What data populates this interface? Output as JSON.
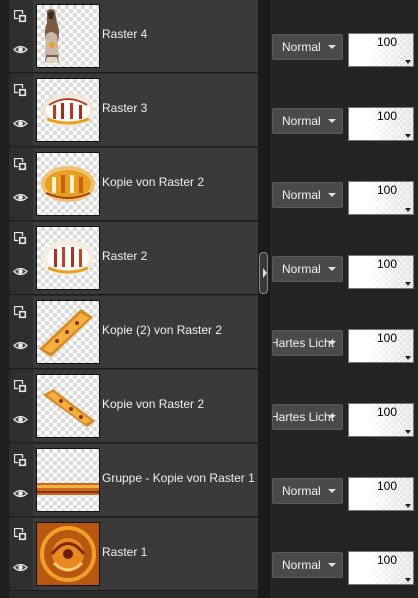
{
  "layers": [
    {
      "name": "Raster 4",
      "thumbnail": "woman-figure",
      "type_icon": "layer-type-icon",
      "visibility_icon": "eye-icon"
    },
    {
      "name": "Raster 3",
      "thumbnail": "oval-vignette",
      "type_icon": "layer-type-icon",
      "visibility_icon": "eye-icon"
    },
    {
      "name": "Kopie von Raster 2",
      "thumbnail": "gold-oval",
      "type_icon": "layer-type-icon",
      "visibility_icon": "eye-icon"
    },
    {
      "name": "Raster 2",
      "thumbnail": "oval-vignette",
      "type_icon": "layer-type-icon",
      "visibility_icon": "eye-icon"
    },
    {
      "name": "Kopie (2) von Raster 2",
      "thumbnail": "diagonal-strip",
      "type_icon": "layer-type-icon",
      "visibility_icon": "eye-icon"
    },
    {
      "name": "Kopie von Raster 2",
      "thumbnail": "diagonal-strip-thin",
      "type_icon": "layer-type-icon",
      "visibility_icon": "eye-icon"
    },
    {
      "name": "Gruppe - Kopie von Raster 1",
      "thumbnail": "bottom-border",
      "type_icon": "layer-type-icon",
      "visibility_icon": "eye-icon"
    },
    {
      "name": "Raster 1",
      "thumbnail": "orange-fractal",
      "type_icon": "layer-type-icon",
      "visibility_icon": "eye-icon"
    }
  ],
  "properties": [
    {
      "blend_mode": "Normal",
      "opacity": "100"
    },
    {
      "blend_mode": "Normal",
      "opacity": "100"
    },
    {
      "blend_mode": "Normal",
      "opacity": "100"
    },
    {
      "blend_mode": "Normal",
      "opacity": "100"
    },
    {
      "blend_mode": "Hartes Licht",
      "opacity": "100"
    },
    {
      "blend_mode": "Hartes Licht",
      "opacity": "100"
    },
    {
      "blend_mode": "Normal",
      "opacity": "100"
    },
    {
      "blend_mode": "Normal",
      "opacity": "100"
    }
  ],
  "colors": {
    "panel": "#3a3a3a",
    "background": "#242424",
    "accent": "#e8a020"
  }
}
